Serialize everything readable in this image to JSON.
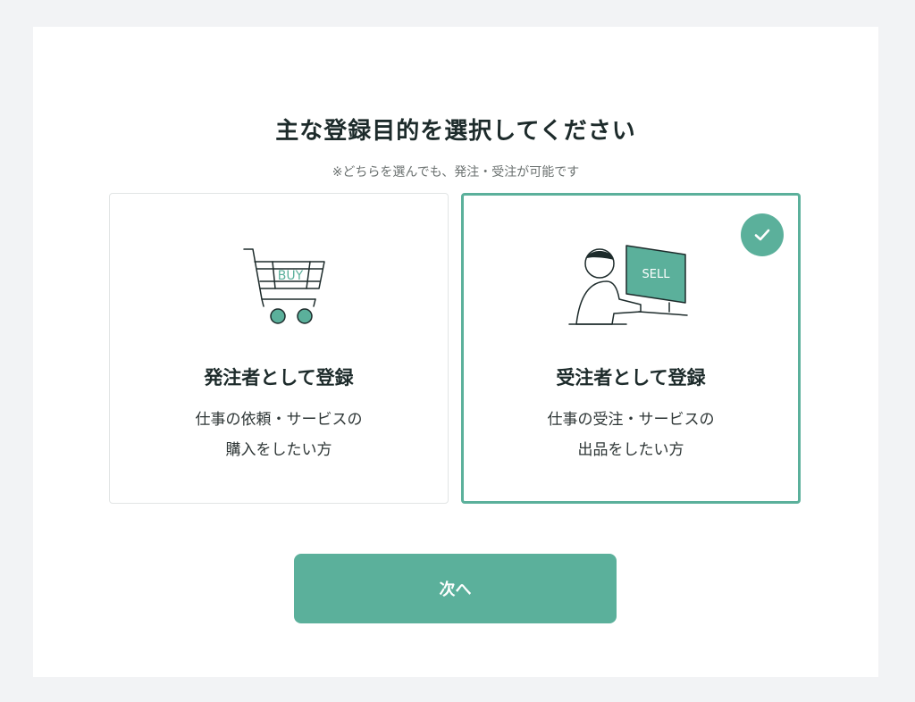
{
  "heading": {
    "title": "主な登録目的を選択してください",
    "note": "※どちらを選んでも、発注・受注が可能です"
  },
  "options": [
    {
      "title": "発注者として登録",
      "desc_line1": "仕事の依頼・サービスの",
      "desc_line2": "購入をしたい方",
      "illustration_text": "BUY",
      "illustration_icon": "shopping-cart-icon",
      "selected": false
    },
    {
      "title": "受注者として登録",
      "desc_line1": "仕事の受注・サービスの",
      "desc_line2": "出品をしたい方",
      "illustration_text": "SELL",
      "illustration_icon": "person-at-monitor-icon",
      "selected": true
    }
  ],
  "next_button": {
    "label": "次へ"
  },
  "colors": {
    "accent": "#5bb09b",
    "background": "#f2f3f5",
    "panel": "#ffffff",
    "text": "#1d2b2b"
  }
}
